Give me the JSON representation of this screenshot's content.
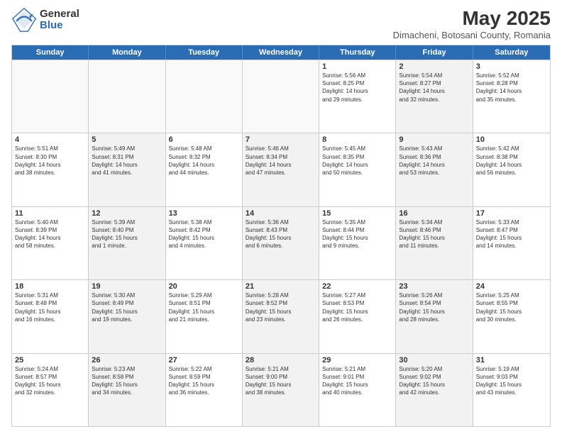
{
  "header": {
    "logo_general": "General",
    "logo_blue": "Blue",
    "month_title": "May 2025",
    "subtitle": "Dimacheni, Botosani County, Romania"
  },
  "calendar": {
    "days_of_week": [
      "Sunday",
      "Monday",
      "Tuesday",
      "Wednesday",
      "Thursday",
      "Friday",
      "Saturday"
    ],
    "rows": [
      [
        {
          "day": "",
          "info": "",
          "empty": true
        },
        {
          "day": "",
          "info": "",
          "empty": true
        },
        {
          "day": "",
          "info": "",
          "empty": true
        },
        {
          "day": "",
          "info": "",
          "empty": true
        },
        {
          "day": "1",
          "info": "Sunrise: 5:56 AM\nSunset: 8:25 PM\nDaylight: 14 hours\nand 29 minutes.",
          "shaded": false
        },
        {
          "day": "2",
          "info": "Sunrise: 5:54 AM\nSunset: 8:27 PM\nDaylight: 14 hours\nand 32 minutes.",
          "shaded": true
        },
        {
          "day": "3",
          "info": "Sunrise: 5:52 AM\nSunset: 8:28 PM\nDaylight: 14 hours\nand 35 minutes.",
          "shaded": false
        }
      ],
      [
        {
          "day": "4",
          "info": "Sunrise: 5:51 AM\nSunset: 8:30 PM\nDaylight: 14 hours\nand 38 minutes.",
          "shaded": false
        },
        {
          "day": "5",
          "info": "Sunrise: 5:49 AM\nSunset: 8:31 PM\nDaylight: 14 hours\nand 41 minutes.",
          "shaded": true
        },
        {
          "day": "6",
          "info": "Sunrise: 5:48 AM\nSunset: 8:32 PM\nDaylight: 14 hours\nand 44 minutes.",
          "shaded": false
        },
        {
          "day": "7",
          "info": "Sunrise: 5:46 AM\nSunset: 8:34 PM\nDaylight: 14 hours\nand 47 minutes.",
          "shaded": true
        },
        {
          "day": "8",
          "info": "Sunrise: 5:45 AM\nSunset: 8:35 PM\nDaylight: 14 hours\nand 50 minutes.",
          "shaded": false
        },
        {
          "day": "9",
          "info": "Sunrise: 5:43 AM\nSunset: 8:36 PM\nDaylight: 14 hours\nand 53 minutes.",
          "shaded": true
        },
        {
          "day": "10",
          "info": "Sunrise: 5:42 AM\nSunset: 8:38 PM\nDaylight: 14 hours\nand 56 minutes.",
          "shaded": false
        }
      ],
      [
        {
          "day": "11",
          "info": "Sunrise: 5:40 AM\nSunset: 8:39 PM\nDaylight: 14 hours\nand 58 minutes.",
          "shaded": false
        },
        {
          "day": "12",
          "info": "Sunrise: 5:39 AM\nSunset: 8:40 PM\nDaylight: 15 hours\nand 1 minute.",
          "shaded": true
        },
        {
          "day": "13",
          "info": "Sunrise: 5:38 AM\nSunset: 8:42 PM\nDaylight: 15 hours\nand 4 minutes.",
          "shaded": false
        },
        {
          "day": "14",
          "info": "Sunrise: 5:36 AM\nSunset: 8:43 PM\nDaylight: 15 hours\nand 6 minutes.",
          "shaded": true
        },
        {
          "day": "15",
          "info": "Sunrise: 5:35 AM\nSunset: 8:44 PM\nDaylight: 15 hours\nand 9 minutes.",
          "shaded": false
        },
        {
          "day": "16",
          "info": "Sunrise: 5:34 AM\nSunset: 8:46 PM\nDaylight: 15 hours\nand 11 minutes.",
          "shaded": true
        },
        {
          "day": "17",
          "info": "Sunrise: 5:33 AM\nSunset: 8:47 PM\nDaylight: 15 hours\nand 14 minutes.",
          "shaded": false
        }
      ],
      [
        {
          "day": "18",
          "info": "Sunrise: 5:31 AM\nSunset: 8:48 PM\nDaylight: 15 hours\nand 16 minutes.",
          "shaded": false
        },
        {
          "day": "19",
          "info": "Sunrise: 5:30 AM\nSunset: 8:49 PM\nDaylight: 15 hours\nand 19 minutes.",
          "shaded": true
        },
        {
          "day": "20",
          "info": "Sunrise: 5:29 AM\nSunset: 8:51 PM\nDaylight: 15 hours\nand 21 minutes.",
          "shaded": false
        },
        {
          "day": "21",
          "info": "Sunrise: 5:28 AM\nSunset: 8:52 PM\nDaylight: 15 hours\nand 23 minutes.",
          "shaded": true
        },
        {
          "day": "22",
          "info": "Sunrise: 5:27 AM\nSunset: 8:53 PM\nDaylight: 15 hours\nand 26 minutes.",
          "shaded": false
        },
        {
          "day": "23",
          "info": "Sunrise: 5:26 AM\nSunset: 8:54 PM\nDaylight: 15 hours\nand 28 minutes.",
          "shaded": true
        },
        {
          "day": "24",
          "info": "Sunrise: 5:25 AM\nSunset: 8:55 PM\nDaylight: 15 hours\nand 30 minutes.",
          "shaded": false
        }
      ],
      [
        {
          "day": "25",
          "info": "Sunrise: 5:24 AM\nSunset: 8:57 PM\nDaylight: 15 hours\nand 32 minutes.",
          "shaded": false
        },
        {
          "day": "26",
          "info": "Sunrise: 5:23 AM\nSunset: 8:58 PM\nDaylight: 15 hours\nand 34 minutes.",
          "shaded": true
        },
        {
          "day": "27",
          "info": "Sunrise: 5:22 AM\nSunset: 8:59 PM\nDaylight: 15 hours\nand 36 minutes.",
          "shaded": false
        },
        {
          "day": "28",
          "info": "Sunrise: 5:21 AM\nSunset: 9:00 PM\nDaylight: 15 hours\nand 38 minutes.",
          "shaded": true
        },
        {
          "day": "29",
          "info": "Sunrise: 5:21 AM\nSunset: 9:01 PM\nDaylight: 15 hours\nand 40 minutes.",
          "shaded": false
        },
        {
          "day": "30",
          "info": "Sunrise: 5:20 AM\nSunset: 9:02 PM\nDaylight: 15 hours\nand 42 minutes.",
          "shaded": true
        },
        {
          "day": "31",
          "info": "Sunrise: 5:19 AM\nSunset: 9:03 PM\nDaylight: 15 hours\nand 43 minutes.",
          "shaded": false
        }
      ]
    ]
  }
}
